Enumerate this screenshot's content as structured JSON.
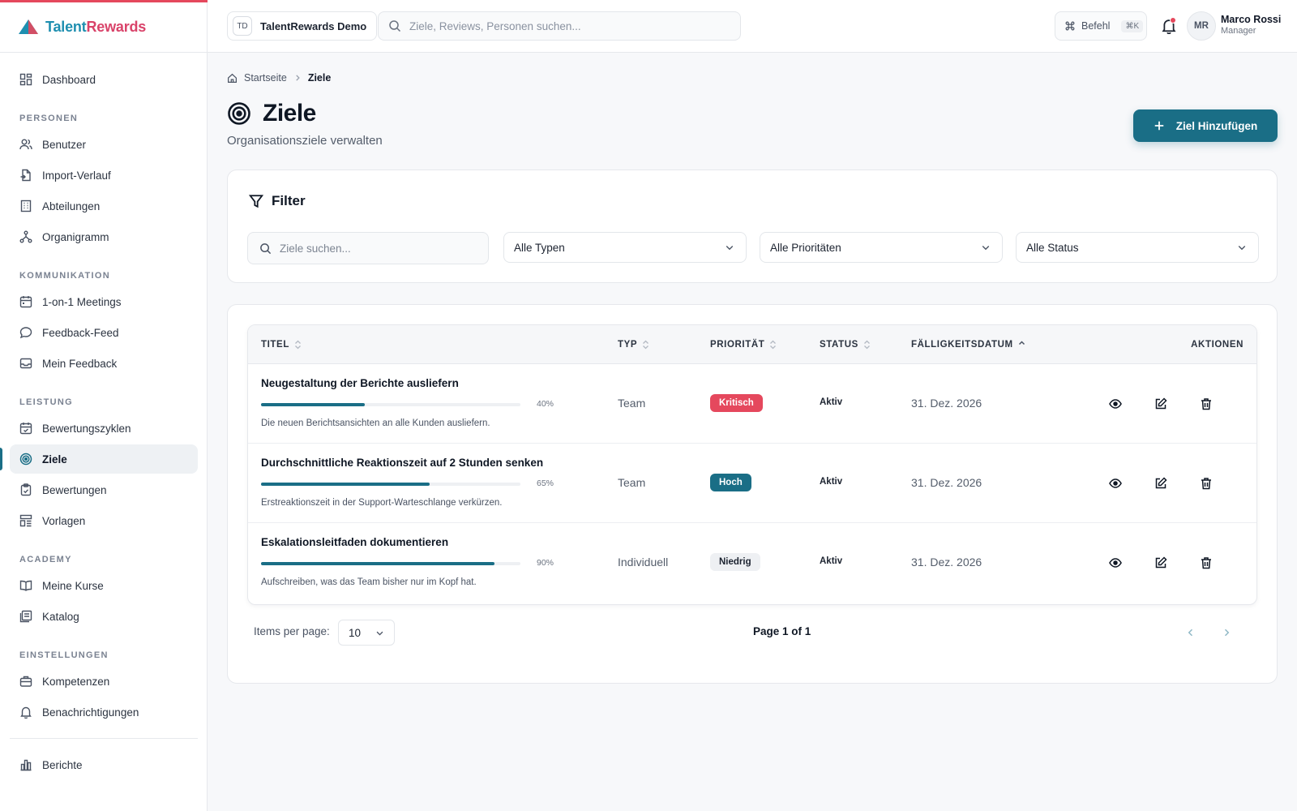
{
  "app": {
    "logo_text_a": "Talent",
    "logo_text_b": "Rewards"
  },
  "sidebar": {
    "dashboard": "Dashboard",
    "sections": {
      "people": "PERSONEN",
      "communication": "KOMMUNIKATION",
      "performance": "LEISTUNG",
      "academy": "ACADEMY",
      "settings": "EINSTELLUNGEN"
    },
    "people_items": [
      "Benutzer",
      "Import-Verlauf",
      "Abteilungen",
      "Organigramm"
    ],
    "communication_items": [
      "1-on-1 Meetings",
      "Feedback-Feed",
      "Mein Feedback"
    ],
    "performance_items": [
      "Bewertungszyklen",
      "Ziele",
      "Bewertungen",
      "Vorlagen"
    ],
    "academy_items": [
      "Meine Kurse",
      "Katalog"
    ],
    "settings_items": [
      "Kompetenzen",
      "Benachrichtigungen"
    ],
    "reports": "Berichte",
    "active_item": "Ziele"
  },
  "header": {
    "org_badge": "TD",
    "org_name": "TalentRewards Demo",
    "search_placeholder": "Ziele, Reviews, Personen suchen...",
    "command_label": "Befehl",
    "command_shortcut": "⌘K",
    "has_notification": true,
    "user_initials": "MR",
    "user_name": "Marco Rossi",
    "user_role": "Manager"
  },
  "breadcrumb": {
    "home": "Startseite",
    "current": "Ziele"
  },
  "page": {
    "title": "Ziele",
    "subtitle": "Organisationsziele verwalten",
    "add_button": "Ziel Hinzufügen"
  },
  "filter": {
    "title": "Filter",
    "search_placeholder": "Ziele suchen...",
    "type_select": "Alle Typen",
    "priority_select": "Alle Prioritäten",
    "status_select": "Alle Status"
  },
  "table": {
    "headers": {
      "title": "TITEL",
      "type": "TYP",
      "priority": "PRIORITÄT",
      "status": "STATUS",
      "due": "FÄLLIGKEITSDATUM",
      "actions": "AKTIONEN"
    },
    "rows": [
      {
        "title": "Neugestaltung der Berichte ausliefern",
        "progress": 40,
        "progress_label": "40%",
        "description": "Die neuen Berichtsansichten an alle Kunden ausliefern.",
        "type": "Team",
        "priority": "Kritisch",
        "priority_bg": "#e5485d",
        "priority_fg": "#ffffff",
        "status": "Aktiv",
        "due": "31. Dez. 2026"
      },
      {
        "title": "Durchschnittliche Reaktionszeit auf 2 Stunden senken",
        "progress": 65,
        "progress_label": "65%",
        "description": "Erstreaktionszeit in der Support-Warteschlange verkürzen.",
        "type": "Team",
        "priority": "Hoch",
        "priority_bg": "#1a6e86",
        "priority_fg": "#ffffff",
        "status": "Aktiv",
        "due": "31. Dez. 2026"
      },
      {
        "title": "Eskalationsleitfaden dokumentieren",
        "progress": 90,
        "progress_label": "90%",
        "description": "Aufschreiben, was das Team bisher nur im Kopf hat.",
        "type": "Individuell",
        "priority": "Niedrig",
        "priority_bg": "#eef0f3",
        "priority_fg": "#1c2330",
        "status": "Aktiv",
        "due": "31. Dez. 2026"
      }
    ]
  },
  "pagination": {
    "items_per_page_label": "Items per page:",
    "items_per_page_value": "10",
    "page_label": "Page 1 of 1"
  },
  "colors": {
    "accent": "#1a6e86",
    "brand_red": "#e5485d"
  }
}
